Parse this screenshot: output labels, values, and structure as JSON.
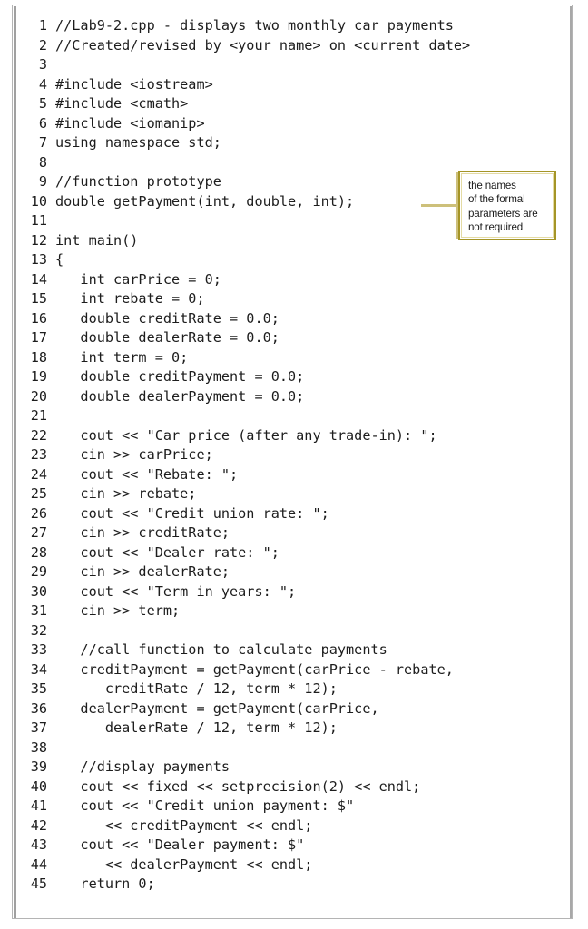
{
  "document": {
    "kind": "code-listing",
    "language": "C++",
    "frame_border_color": "#b4b4b4",
    "text_color": "#1d1d1d",
    "background_color": "#ffffff"
  },
  "code": {
    "lines": [
      {
        "n": "1",
        "text": "//Lab9-2.cpp - displays two monthly car payments"
      },
      {
        "n": "2",
        "text": "//Created/revised by <your name> on <current date>"
      },
      {
        "n": "3",
        "text": ""
      },
      {
        "n": "4",
        "text": "#include <iostream>"
      },
      {
        "n": "5",
        "text": "#include <cmath>"
      },
      {
        "n": "6",
        "text": "#include <iomanip>"
      },
      {
        "n": "7",
        "text": "using namespace std;"
      },
      {
        "n": "8",
        "text": ""
      },
      {
        "n": "9",
        "text": "//function prototype"
      },
      {
        "n": "10",
        "text": "double getPayment(int, double, int);"
      },
      {
        "n": "11",
        "text": ""
      },
      {
        "n": "12",
        "text": "int main()"
      },
      {
        "n": "13",
        "text": "{"
      },
      {
        "n": "14",
        "text": "   int carPrice = 0;"
      },
      {
        "n": "15",
        "text": "   int rebate = 0;"
      },
      {
        "n": "16",
        "text": "   double creditRate = 0.0;"
      },
      {
        "n": "17",
        "text": "   double dealerRate = 0.0;"
      },
      {
        "n": "18",
        "text": "   int term = 0;"
      },
      {
        "n": "19",
        "text": "   double creditPayment = 0.0;"
      },
      {
        "n": "20",
        "text": "   double dealerPayment = 0.0;"
      },
      {
        "n": "21",
        "text": ""
      },
      {
        "n": "22",
        "text": "   cout << \"Car price (after any trade-in): \";"
      },
      {
        "n": "23",
        "text": "   cin >> carPrice;"
      },
      {
        "n": "24",
        "text": "   cout << \"Rebate: \";"
      },
      {
        "n": "25",
        "text": "   cin >> rebate;"
      },
      {
        "n": "26",
        "text": "   cout << \"Credit union rate: \";"
      },
      {
        "n": "27",
        "text": "   cin >> creditRate;"
      },
      {
        "n": "28",
        "text": "   cout << \"Dealer rate: \";"
      },
      {
        "n": "29",
        "text": "   cin >> dealerRate;"
      },
      {
        "n": "30",
        "text": "   cout << \"Term in years: \";"
      },
      {
        "n": "31",
        "text": "   cin >> term;"
      },
      {
        "n": "32",
        "text": ""
      },
      {
        "n": "33",
        "text": "   //call function to calculate payments"
      },
      {
        "n": "34",
        "text": "   creditPayment = getPayment(carPrice - rebate,"
      },
      {
        "n": "35",
        "text": "      creditRate / 12, term * 12);"
      },
      {
        "n": "36",
        "text": "   dealerPayment = getPayment(carPrice,"
      },
      {
        "n": "37",
        "text": "      dealerRate / 12, term * 12);"
      },
      {
        "n": "38",
        "text": ""
      },
      {
        "n": "39",
        "text": "   //display payments"
      },
      {
        "n": "40",
        "text": "   cout << fixed << setprecision(2) << endl;"
      },
      {
        "n": "41",
        "text": "   cout << \"Credit union payment: $\""
      },
      {
        "n": "42",
        "text": "      << creditPayment << endl;"
      },
      {
        "n": "43",
        "text": "   cout << \"Dealer payment: $\""
      },
      {
        "n": "44",
        "text": "      << dealerPayment << endl;"
      },
      {
        "n": "45",
        "text": "   return 0;"
      }
    ]
  },
  "callout": {
    "text": "the names\nof the formal\nparameters are\nnot required",
    "border_color": "#a59527",
    "inner_border_color": "#e4dba4",
    "leader_color": "#cdc07a",
    "target_line": "10"
  }
}
